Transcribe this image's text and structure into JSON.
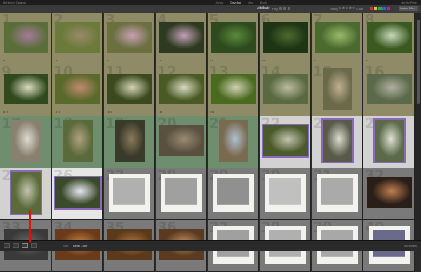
{
  "app": {
    "title": "Lightroom Catalog"
  },
  "modules": [
    "Library",
    "Develop",
    "Map",
    "Book"
  ],
  "active_module": "Develop",
  "user": "Identity Plate",
  "filter": {
    "attribute_label": "Attribute",
    "flag_label": "Flag",
    "rating_label": "Rating",
    "stars": "★★★★★",
    "color_label": "Color",
    "swatches": [
      "#c33",
      "#cc3",
      "#3a3",
      "#36c",
      "#939"
    ],
    "preset": "Custom Filter"
  },
  "grid": {
    "rows": [
      {
        "bg": "#8e8b66",
        "cells": [
          {
            "num": "1",
            "colors": [
              "#5a6e3a",
              "#a77a9a"
            ],
            "dots": "••"
          },
          {
            "num": "2",
            "colors": [
              "#6a7a3a",
              "#9a8a6a"
            ],
            "dots": "••"
          },
          {
            "num": "3",
            "colors": [
              "#6a7040",
              "#c9a0b4"
            ],
            "dots": "••"
          },
          {
            "num": "4",
            "colors": [
              "#2d3a20",
              "#c4a0b8"
            ],
            "dots": "••"
          },
          {
            "num": "5",
            "colors": [
              "#2e4a1e",
              "#5a8a3a"
            ],
            "dots": "••"
          },
          {
            "num": "6",
            "colors": [
              "#1e3414",
              "#4e6a2e"
            ],
            "dots": "••"
          },
          {
            "num": "7",
            "colors": [
              "#4a6a2e",
              "#9aba6a"
            ],
            "dots": "••"
          },
          {
            "num": "8",
            "colors": [
              "#3a5a22",
              "#c9d9b9"
            ],
            "dots": "••"
          }
        ]
      },
      {
        "bg": "#8e8b66",
        "cells": [
          {
            "num": "9",
            "colors": [
              "#304a1e",
              "#dcdcc0"
            ],
            "dots": "••••"
          },
          {
            "num": "10",
            "colors": [
              "#5a6a2a",
              "#c08a70"
            ],
            "dots": "••••"
          },
          {
            "num": "11",
            "colors": [
              "#3a4a1e",
              "#d4d4b4"
            ],
            "dots": "••••"
          },
          {
            "num": "12",
            "colors": [
              "#4a5a24",
              "#d8d8c0"
            ],
            "dots": "••••"
          },
          {
            "num": "13",
            "colors": [
              "#4a6a20",
              "#d0d0b0"
            ],
            "dots": "••••"
          },
          {
            "num": "14",
            "colors": [
              "#5a6a40",
              "#bdbda0"
            ],
            "dots": ""
          },
          {
            "num": "15",
            "colors": [
              "#6a6a4a",
              "#c0b090"
            ],
            "dots": ""
          },
          {
            "num": "16",
            "colors": [
              "#5a6a4a",
              "#b0b0a0"
            ],
            "dots": ""
          }
        ]
      },
      {
        "bg": "#6f8e6e",
        "cells": [
          {
            "num": "17",
            "colors": [
              "#8a8070",
              "#dcdcd0"
            ],
            "dots": ""
          },
          {
            "num": "18",
            "colors": [
              "#5a6a3a",
              "#b0a080"
            ],
            "dots": ""
          },
          {
            "num": "19",
            "colors": [
              "#3a3a2a",
              "#8a7a5a"
            ],
            "dots": ""
          },
          {
            "num": "20",
            "colors": [
              "#5a5040",
              "#9a8a70"
            ],
            "dots": ""
          },
          {
            "num": "21",
            "colors": [
              "#7a6a50",
              "#b0c0d0"
            ],
            "dots": ""
          },
          {
            "num": "22",
            "colors": [
              "#4a5a2a",
              "#c4c4b0"
            ],
            "dots": ""
          },
          {
            "num": "23",
            "colors": [
              "#5a5a4a",
              "#dcdcd0"
            ],
            "dots": ""
          },
          {
            "num": "24",
            "colors": [
              "#5a6a4a",
              "#e0e0d0"
            ],
            "dots": ""
          }
        ]
      },
      {
        "bg": "#7a7a7a",
        "cells": [
          {
            "num": "25",
            "colors": [
              "#5a6a3a",
              "#c4c4b0"
            ],
            "dots": ""
          },
          {
            "num": "26",
            "colors": [
              "#3a4a2a",
              "#e8e8f0"
            ],
            "dots": ""
          },
          {
            "num": "27",
            "colors": [
              "#606060",
              "#b0b0b0"
            ],
            "dots": ""
          },
          {
            "num": "28",
            "colors": [
              "#3a3a3a",
              "#a0a0a0"
            ],
            "dots": ""
          },
          {
            "num": "29",
            "colors": [
              "#505050",
              "#909090"
            ],
            "dots": ""
          },
          {
            "num": "30",
            "colors": [
              "#8a8a8a",
              "#c0c0c0"
            ],
            "dots": ""
          },
          {
            "num": "31",
            "colors": [
              "#3a3a3a",
              "#aaaaaa"
            ],
            "dots": ""
          },
          {
            "num": "32",
            "colors": [
              "#2a1e18",
              "#c08050"
            ],
            "dots": ""
          }
        ]
      },
      {
        "bg": "#7a7a7a",
        "cells": [
          {
            "num": "33",
            "colors": [
              "#3a3a3a",
              "#6a6a6a"
            ],
            "dots": ""
          },
          {
            "num": "34",
            "colors": [
              "#6a3a1a",
              "#c08040"
            ],
            "dots": ""
          },
          {
            "num": "35",
            "colors": [
              "#5a3a1a",
              "#b07040"
            ],
            "dots": ""
          },
          {
            "num": "36",
            "colors": [
              "#5a3a20",
              "#c09060"
            ],
            "dots": ""
          },
          {
            "num": "37",
            "colors": [
              "#6a6a6a",
              "#a0a0a0"
            ],
            "dots": ""
          },
          {
            "num": "38",
            "colors": [
              "#7a7a7a",
              "#b0b0b0"
            ],
            "dots": ""
          },
          {
            "num": "39",
            "colors": [
              "#6a6a6a",
              "#a8a8a8"
            ],
            "dots": ""
          },
          {
            "num": "40",
            "colors": [
              "#2a2a3a",
              "#6a6a8a"
            ],
            "dots": ""
          }
        ]
      }
    ],
    "selected": [
      "22",
      "23",
      "24",
      "25",
      "26"
    ],
    "bright_bg": [
      "22",
      "23",
      "24",
      "25",
      "26"
    ]
  },
  "bottom": {
    "sort_label": "Sort",
    "sort_value": "Label Color",
    "thumbnails_label": "Thumbnails"
  },
  "annotation": {
    "arrow_color": "#e01010"
  }
}
